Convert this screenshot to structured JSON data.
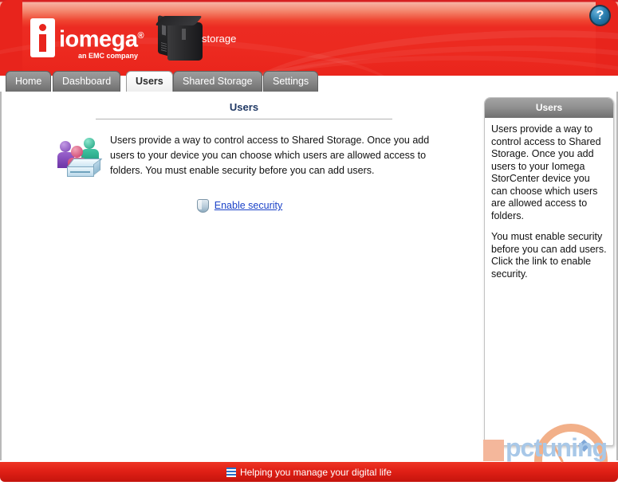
{
  "header": {
    "brand_name": "iomega",
    "brand_reg": "®",
    "brand_tagline": "an EMC company",
    "device_label": "storage",
    "help_glyph": "?",
    "colors": {
      "red": "#e8241c",
      "red_dark": "#c5140d",
      "tab_grey": "#8d8d8d"
    }
  },
  "tabs": [
    {
      "label": "Home",
      "active": false
    },
    {
      "label": "Dashboard",
      "active": false
    },
    {
      "label": "Users",
      "active": true
    },
    {
      "label": "Shared Storage",
      "active": false
    },
    {
      "label": "Settings",
      "active": false
    }
  ],
  "main": {
    "page_title": "Users",
    "intro_text": "Users provide a way to control access to Shared Storage. Once you add users to your device you can choose which users are allowed access to folders. You must enable security before you can add users.",
    "enable_link_label": "Enable security",
    "link_color": "#1b42c8"
  },
  "sidepanel": {
    "title": "Users",
    "paragraphs": [
      "Users provide a way to control access to Shared Storage. Once you add users to your Iomega StorCenter device you can choose which users are allowed access to folders.",
      "You must enable security before you can add users. Click the link to enable security."
    ]
  },
  "footer": {
    "text": "Helping you manage your digital life"
  },
  "watermark": {
    "text": "pctuning"
  }
}
